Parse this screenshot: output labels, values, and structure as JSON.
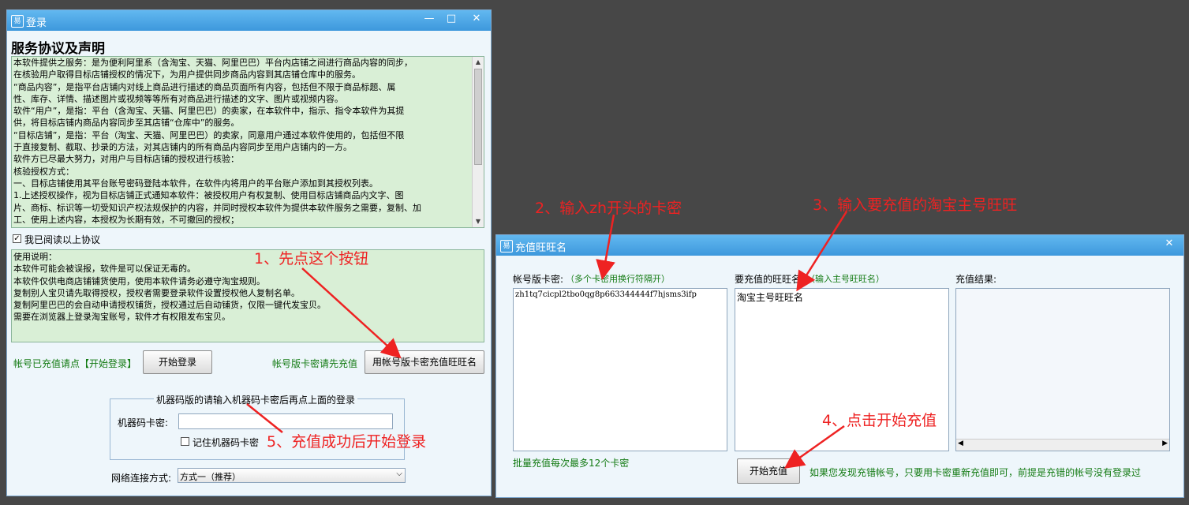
{
  "login_window": {
    "title": "登录",
    "agreement_heading": "服务协议及声明",
    "agreement_lines": [
      "      本软件提供之服务：是为便利阿里系（含淘宝、天猫、阿里巴巴）平台内店铺之间进行商品内容的同步，",
      "在核验用户取得目标店铺授权的情况下，为用户提供同步商品内容到其店铺仓库中的服务。",
      "      “商品内容”，是指平台店铺内对线上商品进行描述的商品页面所有内容，包括但不限于商品标题、属",
      "性、库存、详情、描述图片或视频等等所有对商品进行描述的文字、图片或视频内容。",
      "      软件“用户”，是指：平台（含淘宝、天猫、阿里巴巴）的卖家，在本软件中，指示、指令本软件为其提",
      "供，将目标店铺内商品内容同步至其店铺“仓库中”的服务。",
      "      “目标店铺”，是指：平台（淘宝、天猫、阿里巴巴）的卖家，同意用户通过本软件使用的，包括但不限",
      "于直接复制、截取、抄录的方法，对其店铺内的所有商品内容同步至用户店铺内的一方。",
      "      软件方已尽最大努力，对用户与目标店铺的授权进行核验：",
      "      核验授权方式：",
      "      一、目标店铺使用其平台账号密码登陆本软件，在软件内将用户的平台账户添加到其授权列表。",
      "      1.上述授权操作，视为目标店铺正式通知本软件：被授权用户有权复制、使用目标店铺商品内文字、图",
      "片、商标、标识等一切受知识产权法规保护的内容，并同时授权本软件为提供本软件服务之需要，复制、加",
      "工、使用上述内容，本授权为长期有效，不可撤回的授权；"
    ],
    "read_agreement_label": "我已阅读以上协议",
    "usage_lines": [
      "使用说明：",
      "      本软件可能会被误报，软件是可以保证无毒的。",
      "      本软件仅供电商店铺铺货使用，使用本软件请务必遵守淘宝规则。",
      "      复制别人宝贝请先取得授权，授权者需要登录软件设置授权他人复制名单。",
      "      复制阿里巴巴的会自动申请授权铺货，授权通过后自动铺货，仅限一键代发宝贝。",
      "      需要在浏览器上登录淘宝账号，软件才有权限发布宝贝。"
    ],
    "charged_hint": "帐号已充值请点【开始登录】",
    "start_login_label": "开始登录",
    "card_first_hint": "帐号版卡密请先充值",
    "recharge_button_label": "用帐号版卡密充值旺旺名",
    "machine_legend": "机器码版的请输入机器码卡密后再点上面的登录",
    "machine_code_label": "机器码卡密:",
    "machine_code_value": "",
    "remember_label": "记住机器码卡密",
    "network_label": "网络连接方式:",
    "network_selected": "方式一（推荐）"
  },
  "recharge_window": {
    "title": "充值旺旺名",
    "card_label": "帐号版卡密:",
    "card_hint": "（多个卡密用换行符隔开）",
    "card_value": "zh1tq7cicpl2tbo0qg8p663344444f7hjsms3ifp",
    "wangwang_label": "要充值的旺旺名:",
    "wangwang_hint": "（输入主号旺旺名）",
    "wangwang_value": "淘宝主号旺旺名",
    "result_label": "充值结果:",
    "batch_hint": "批量充值每次最多12个卡密",
    "start_recharge_label": "开始充值",
    "bottom_hint": "如果您发现充错帐号，只要用卡密重新充值即可，前提是充错的帐号没有登录过"
  },
  "annotations": {
    "step1": "1、先点这个按钮",
    "step2": "2、输入zh开头的卡密",
    "step3": "3、输入要充值的淘宝主号旺旺",
    "step4": "4、点击开始充值",
    "step5": "5、充值成功后开始登录"
  },
  "colors": {
    "titlebar": "#3d98dc",
    "window_bg": "#eef6fb",
    "text_area_bg": "#d9efd6",
    "hint_green": "#127a12",
    "annotation_red": "#ee2222",
    "desktop": "#474747"
  }
}
